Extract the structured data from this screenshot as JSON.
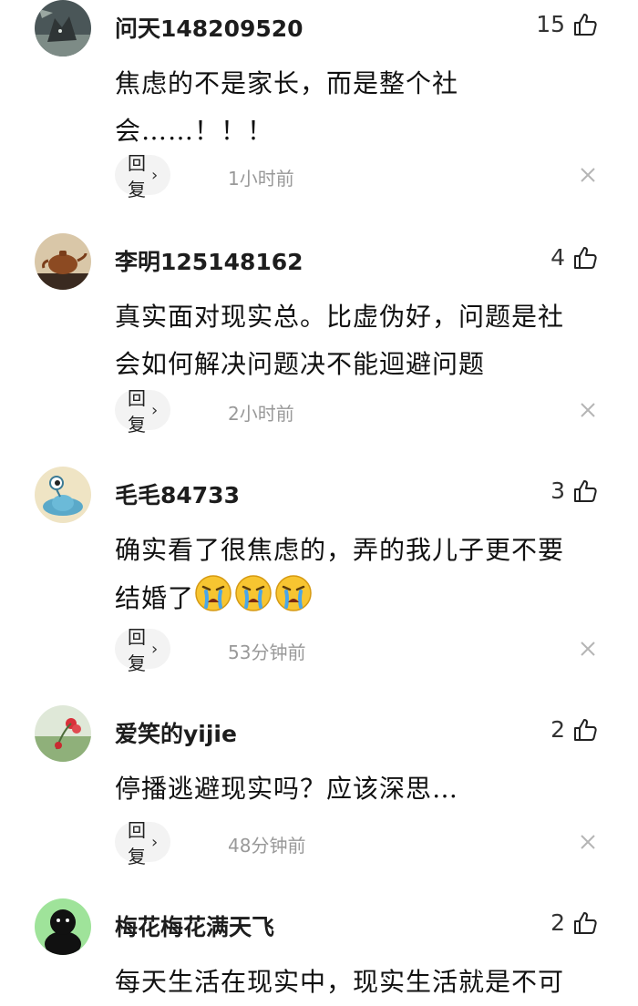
{
  "comments": [
    {
      "username": "问天148209520",
      "likes": "15",
      "text_lines": [
        "焦虑的不是家长，而是整个社",
        "会……！！！"
      ],
      "reply_label": "回复",
      "time": "1小时前",
      "avatar_icon": "wolf-avatar-icon"
    },
    {
      "username": "李明125148162",
      "likes": "4",
      "text_lines": [
        "真实面对现实总。比虚伪好，问题是社",
        "会如何解决问题决不能迴避问题"
      ],
      "reply_label": "回复",
      "time": "2小时前",
      "avatar_icon": "teapot-avatar-icon"
    },
    {
      "username": "毛毛84733",
      "likes": "3",
      "text_lines": [
        "确实看了很焦虑的，弄的我儿子更不要",
        "结婚了"
      ],
      "emoji_count": 3,
      "emoji_icon": "crying-face-emoji",
      "reply_label": "回复",
      "time": "53分钟前",
      "avatar_icon": "cartoon-alien-avatar-icon"
    },
    {
      "username": "爱笑的yijie",
      "likes": "2",
      "text_lines": [
        "停播逃避现实吗？应该深思…"
      ],
      "reply_label": "回复",
      "time": "48分钟前",
      "avatar_icon": "flower-avatar-icon"
    },
    {
      "username": "梅花梅花满天飞",
      "likes": "2",
      "text_lines": [
        "每天生活在现实中，现实生活就是不可"
      ],
      "avatar_icon": "black-figure-avatar-icon"
    }
  ],
  "colors": {
    "username": "#1d1d1d",
    "time": "#999999",
    "reply_bg": "#f3f3f3",
    "emoji_yellow": "#f7c531"
  }
}
